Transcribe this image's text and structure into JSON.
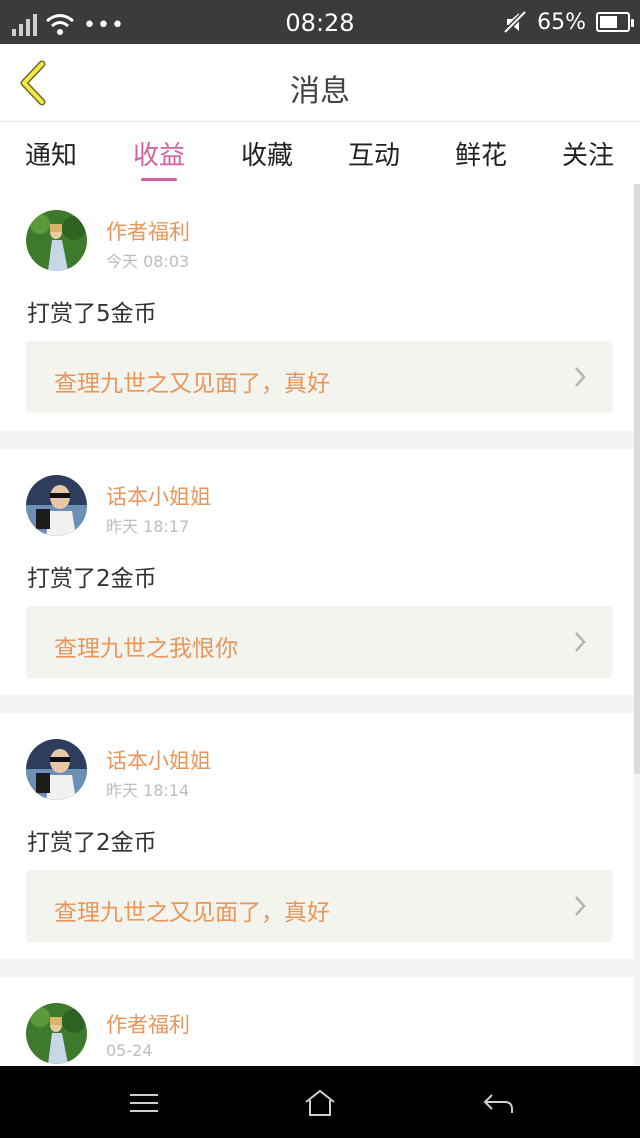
{
  "status_bar": {
    "time": "08:28",
    "battery": "65%",
    "battery_level": 0.65,
    "signal_icon": "signal-icon",
    "wifi_icon": "wifi-icon",
    "mute_icon": "mute-icon"
  },
  "header": {
    "title": "消息",
    "back_icon": "back-chevron-icon",
    "accent_color": "#d4609f"
  },
  "tabs": [
    {
      "label": "通知",
      "active": false
    },
    {
      "label": "收益",
      "active": true
    },
    {
      "label": "收藏",
      "active": false
    },
    {
      "label": "互动",
      "active": false
    },
    {
      "label": "鲜花",
      "active": false
    },
    {
      "label": "关注",
      "active": false
    }
  ],
  "messages": [
    {
      "name": "作者福利",
      "time": "今天 08:03",
      "action": "打赏了5金币",
      "work": "查理九世之又见面了，真好"
    },
    {
      "name": "话本小姐姐",
      "time": "昨天 18:17",
      "action": "打赏了2金币",
      "work": "查理九世之我恨你"
    },
    {
      "name": "话本小姐姐",
      "time": "昨天 18:14",
      "action": "打赏了2金币",
      "work": "查理九世之又见面了，真好"
    },
    {
      "name": "作者福利",
      "time": "05-24"
    }
  ],
  "nav": {
    "menu_icon": "menu-icon",
    "home_icon": "home-icon",
    "back_icon": "back-arrow-icon"
  }
}
